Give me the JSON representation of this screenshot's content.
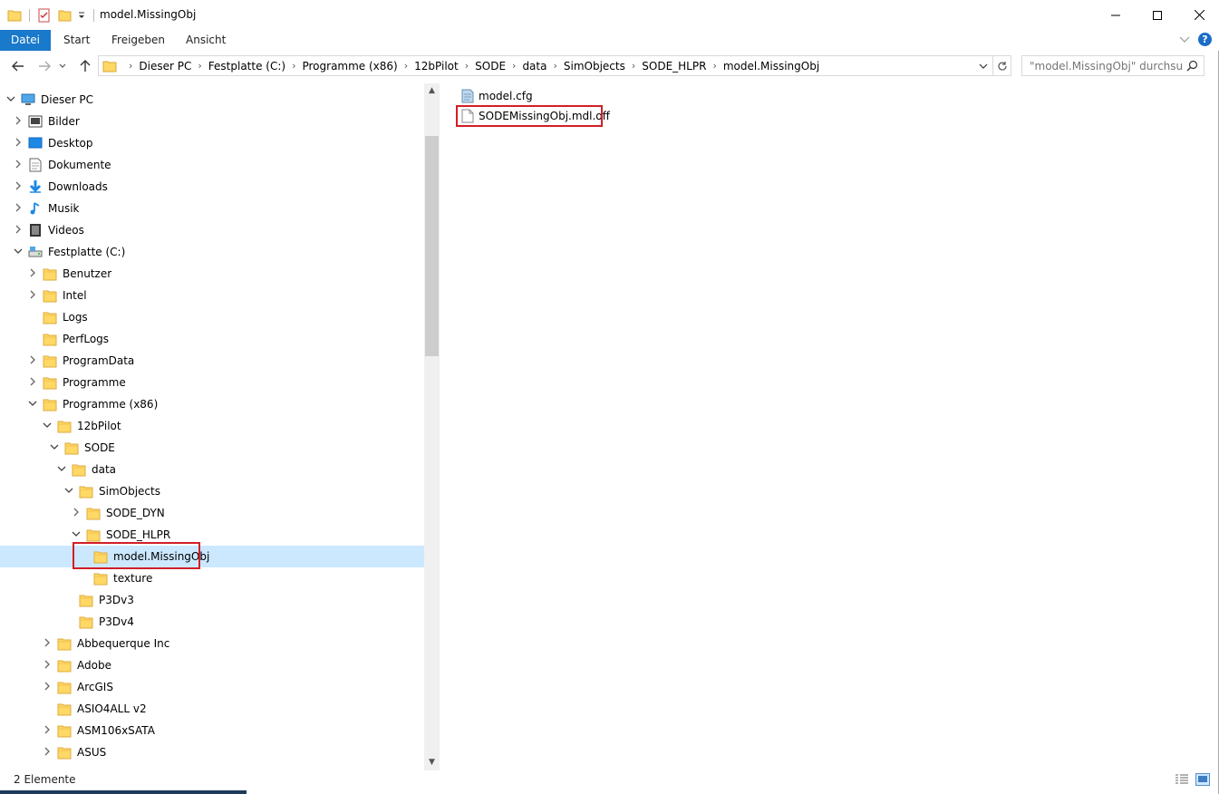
{
  "window": {
    "title": "model.MissingObj",
    "accent": "#1979ca",
    "controls": [
      "minimize-icon",
      "maximize-icon",
      "close-icon"
    ]
  },
  "ribbon": {
    "tabs": [
      "Datei",
      "Start",
      "Freigeben",
      "Ansicht"
    ],
    "help": "?"
  },
  "address": {
    "crumbs": [
      "Dieser PC",
      "Festplatte (C:)",
      "Programme (x86)",
      "12bPilot",
      "SODE",
      "data",
      "SimObjects",
      "SODE_HLPR",
      "model.MissingObj"
    ]
  },
  "search": {
    "placeholder": "\"model.MissingObj\" durchsu..."
  },
  "tree": [
    {
      "label": "Dieser PC",
      "icon": "pc-icon",
      "expanded": true
    },
    {
      "label": "Bilder",
      "icon": "pictures-icon",
      "expandable": true
    },
    {
      "label": "Desktop",
      "icon": "desktop-icon",
      "expandable": true
    },
    {
      "label": "Dokumente",
      "icon": "documents-icon",
      "expandable": true
    },
    {
      "label": "Downloads",
      "icon": "downloads-icon",
      "expandable": true
    },
    {
      "label": "Musik",
      "icon": "music-icon",
      "expandable": true
    },
    {
      "label": "Videos",
      "icon": "videos-icon",
      "expandable": true
    },
    {
      "label": "Festplatte (C:)",
      "icon": "drive-icon",
      "expanded": true
    },
    {
      "label": "Benutzer",
      "icon": "folder-icon",
      "expandable": true
    },
    {
      "label": "Intel",
      "icon": "folder-icon",
      "expandable": true
    },
    {
      "label": "Logs",
      "icon": "folder-icon"
    },
    {
      "label": "PerfLogs",
      "icon": "folder-icon"
    },
    {
      "label": "ProgramData",
      "icon": "folder-icon",
      "expandable": true
    },
    {
      "label": "Programme",
      "icon": "folder-icon",
      "expandable": true
    },
    {
      "label": "Programme (x86)",
      "icon": "folder-icon",
      "expanded": true
    },
    {
      "label": "12bPilot",
      "icon": "folder-icon",
      "expanded": true
    },
    {
      "label": "SODE",
      "icon": "folder-icon",
      "expanded": true
    },
    {
      "label": "data",
      "icon": "folder-icon",
      "expanded": true
    },
    {
      "label": "SimObjects",
      "icon": "folder-icon",
      "expanded": true
    },
    {
      "label": "SODE_DYN",
      "icon": "folder-icon",
      "expandable": true
    },
    {
      "label": "SODE_HLPR",
      "icon": "folder-icon",
      "expanded": true
    },
    {
      "label": "model.MissingObj",
      "icon": "folder-icon",
      "selected": true
    },
    {
      "label": "texture",
      "icon": "folder-icon"
    },
    {
      "label": "P3Dv3",
      "icon": "folder-icon"
    },
    {
      "label": "P3Dv4",
      "icon": "folder-icon"
    },
    {
      "label": "Abbequerque Inc",
      "icon": "folder-icon",
      "expandable": true
    },
    {
      "label": "Adobe",
      "icon": "folder-icon",
      "expandable": true
    },
    {
      "label": "ArcGIS",
      "icon": "folder-icon",
      "expandable": true
    },
    {
      "label": "ASIO4ALL v2",
      "icon": "folder-icon"
    },
    {
      "label": "ASM106xSATA",
      "icon": "folder-icon",
      "expandable": true
    },
    {
      "label": "ASUS",
      "icon": "folder-icon",
      "expandable": true
    }
  ],
  "files": [
    {
      "name": "model.cfg",
      "icon": "config-file-icon"
    },
    {
      "name": "SODEMissingObj.mdl.off",
      "icon": "file-icon",
      "highlighted": true
    }
  ],
  "status": {
    "count": "2 Elemente"
  }
}
